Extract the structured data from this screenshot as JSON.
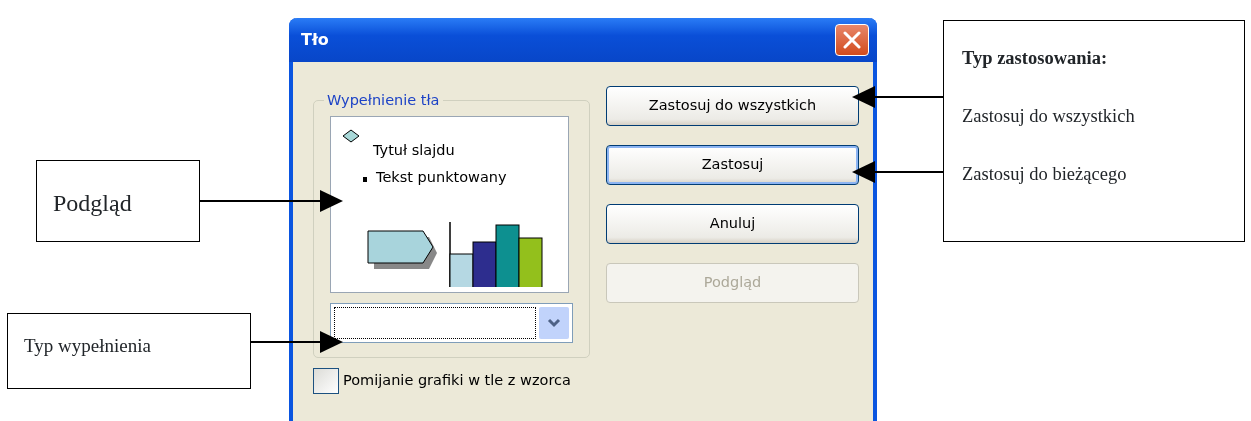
{
  "window": {
    "title": "Tło"
  },
  "fill_group": {
    "label": "Wypełnienie tła",
    "preview": {
      "title": "Tytuł slajdu",
      "bullet_text": "Tekst punktowany"
    }
  },
  "buttons": [
    {
      "label": "Zastosuj do wszystkich",
      "default": false,
      "disabled": false
    },
    {
      "label": "Zastosuj",
      "default": true,
      "disabled": false
    },
    {
      "label": "Anuluj",
      "default": false,
      "disabled": false
    },
    {
      "label": "Podgląd",
      "default": false,
      "disabled": true
    }
  ],
  "checkbox": {
    "label": "Pomijanie grafiki w tle z wzorca",
    "checked": false
  },
  "callouts": [
    {
      "text": "Podgląd"
    },
    {
      "text": "Typ wypełnienia"
    },
    {
      "title": "Typ zastosowania:",
      "items": [
        "Zastosuj do wszystkich",
        "Zastosuj do bieżącego"
      ]
    }
  ]
}
